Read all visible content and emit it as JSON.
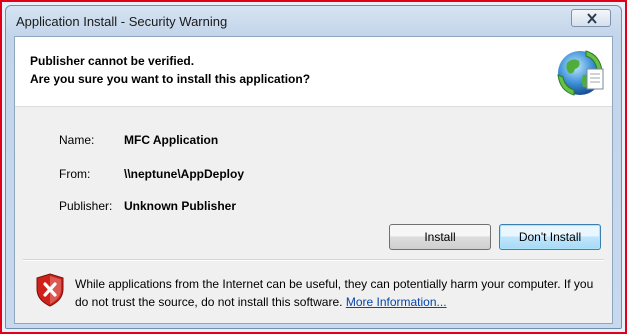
{
  "window": {
    "title": "Application Install - Security Warning"
  },
  "header": {
    "line1": "Publisher cannot be verified.",
    "line2": "Are you sure you want to install this application?",
    "icon": "globe-install-icon"
  },
  "details": [
    {
      "label": "Name:",
      "value": "MFC Application"
    },
    {
      "label": "From:",
      "value": "\\\\neptune\\AppDeploy"
    },
    {
      "label": "Publisher:",
      "value": "Unknown Publisher"
    }
  ],
  "buttons": {
    "install": "Install",
    "dont_install": "Don't Install"
  },
  "warning": {
    "text": "While applications from the Internet can be useful, they can potentially harm your computer. If you do not trust the source, do not install this software.",
    "link": "More Information...",
    "icon": "shield-error-icon"
  },
  "colors": {
    "highlight_border": "#e0001a",
    "link": "#0645ad",
    "shield_red": "#d0201a"
  }
}
